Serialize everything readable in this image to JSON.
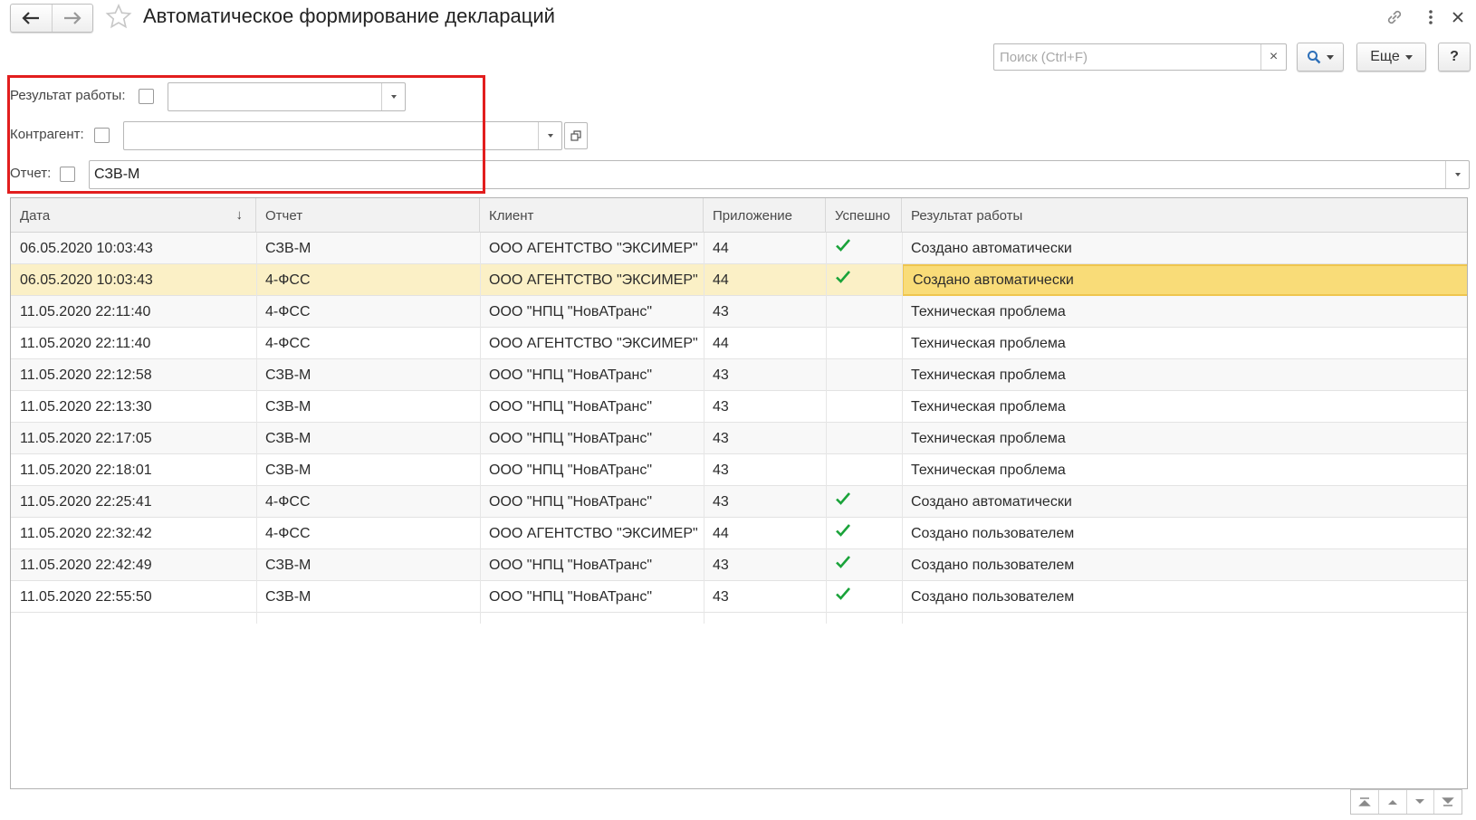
{
  "window": {
    "title": "Автоматическое формирование деклараций"
  },
  "icons": {
    "back": "arrow-left-icon",
    "forward": "arrow-right-icon",
    "favorite": "star-icon",
    "link": "link-icon",
    "more": "vertical-dots-icon",
    "close": "close-icon"
  },
  "command_bar": {
    "search_placeholder": "Поиск (Ctrl+F)",
    "search_clear": "×",
    "more_label": "Еще",
    "help_label": "?"
  },
  "filters": {
    "result_label": "Результат работы:",
    "result_value": "",
    "counterparty_label": "Контрагент:",
    "counterparty_value": "",
    "report_label": "Отчет:",
    "report_value": "СЗВ-М"
  },
  "table": {
    "columns": [
      "Дата",
      "Отчет",
      "Клиент",
      "Приложение",
      "Успешно",
      "Результат работы"
    ],
    "sort_indicator": "↓",
    "rows": [
      {
        "date": "06.05.2020 10:03:43",
        "report": "СЗВ-М",
        "client": "ООО АГЕНТСТВО \"ЭКСИМЕР\"",
        "app": "44",
        "success": true,
        "result": "Создано автоматически"
      },
      {
        "date": "06.05.2020 10:03:43",
        "report": "4-ФСС",
        "client": "ООО АГЕНТСТВО \"ЭКСИМЕР\"",
        "app": "44",
        "success": true,
        "result": "Создано автоматически"
      },
      {
        "date": "11.05.2020 22:11:40",
        "report": "4-ФСС",
        "client": "ООО \"НПЦ \"НовАТранс\"",
        "app": "43",
        "success": false,
        "result": "Техническая проблема"
      },
      {
        "date": "11.05.2020 22:11:40",
        "report": "4-ФСС",
        "client": "ООО АГЕНТСТВО \"ЭКСИМЕР\"",
        "app": "44",
        "success": false,
        "result": "Техническая проблема"
      },
      {
        "date": "11.05.2020 22:12:58",
        "report": "СЗВ-М",
        "client": "ООО \"НПЦ \"НовАТранс\"",
        "app": "43",
        "success": false,
        "result": "Техническая проблема"
      },
      {
        "date": "11.05.2020 22:13:30",
        "report": "СЗВ-М",
        "client": "ООО \"НПЦ \"НовАТранс\"",
        "app": "43",
        "success": false,
        "result": "Техническая проблема"
      },
      {
        "date": "11.05.2020 22:17:05",
        "report": "СЗВ-М",
        "client": "ООО \"НПЦ \"НовАТранс\"",
        "app": "43",
        "success": false,
        "result": "Техническая проблема"
      },
      {
        "date": "11.05.2020 22:18:01",
        "report": "СЗВ-М",
        "client": "ООО \"НПЦ \"НовАТранс\"",
        "app": "43",
        "success": false,
        "result": "Техническая проблема"
      },
      {
        "date": "11.05.2020 22:25:41",
        "report": "4-ФСС",
        "client": "ООО \"НПЦ \"НовАТранс\"",
        "app": "43",
        "success": true,
        "result": "Создано автоматически"
      },
      {
        "date": "11.05.2020 22:32:42",
        "report": "4-ФСС",
        "client": "ООО АГЕНТСТВО \"ЭКСИМЕР\"",
        "app": "44",
        "success": true,
        "result": "Создано пользователем"
      },
      {
        "date": "11.05.2020 22:42:49",
        "report": "СЗВ-М",
        "client": "ООО \"НПЦ \"НовАТранс\"",
        "app": "43",
        "success": true,
        "result": "Создано пользователем"
      },
      {
        "date": "11.05.2020 22:55:50",
        "report": "СЗВ-М",
        "client": "ООО \"НПЦ \"НовАТранс\"",
        "app": "43",
        "success": true,
        "result": "Создано пользователем"
      }
    ],
    "selected_row": 1
  },
  "colors": {
    "checkmark": "#1aa33a",
    "selected_row": "#fbf0c6",
    "current_cell": "#f9dc78",
    "highlight_frame": "#e21e1e"
  }
}
